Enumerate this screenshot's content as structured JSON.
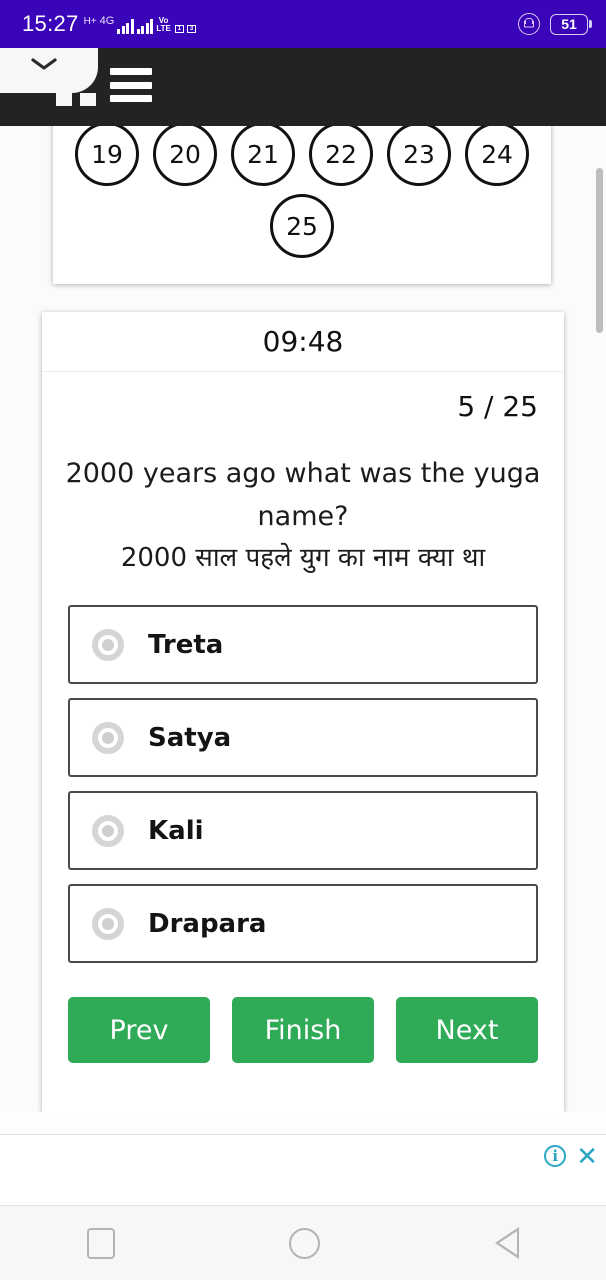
{
  "status_bar": {
    "clock": "15:27",
    "network_hplus": "H+",
    "network_4g": "4G",
    "volte_top": "Vo",
    "volte_bottom": "LTE",
    "sim_badge": "1",
    "sim_badge_2": "3",
    "battery_level": "51",
    "rotation_lock_icon": "rotation-lock-icon",
    "accent_color": "#3a04b8"
  },
  "toolbar": {
    "menu_icon": "hamburger-menu-icon",
    "collapse_icon": "chevron-down-icon",
    "background_color": "#232323"
  },
  "palette": {
    "row1": [
      "19",
      "20",
      "21",
      "22",
      "23",
      "24"
    ],
    "row2": [
      "25"
    ]
  },
  "quiz": {
    "timer": "09:48",
    "counter": "5 / 25",
    "question_en": "2000 years ago what was the yuga name?",
    "question_hi": "2000 साल पहले युग का नाम क्या था",
    "options": [
      {
        "label": "Treta",
        "selected": false
      },
      {
        "label": "Satya",
        "selected": false
      },
      {
        "label": "Kali",
        "selected": false
      },
      {
        "label": "Drapara",
        "selected": false
      }
    ],
    "buttons": {
      "prev": "Prev",
      "finish": "Finish",
      "next": "Next"
    },
    "button_color": "#2faa57"
  },
  "ad_banner": {
    "info_label": "i",
    "close_label": "✕",
    "icon_color": "#2aa5c4"
  },
  "navbar": {
    "recents_icon": "recents-square-icon",
    "home_icon": "home-circle-icon",
    "back_icon": "back-triangle-icon"
  }
}
